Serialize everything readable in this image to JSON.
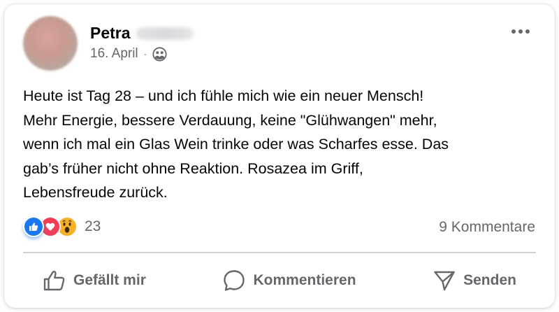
{
  "post": {
    "author_name": "Petra",
    "date": "16. April",
    "separator": "·",
    "audience_icon": "friends-icon",
    "text": "Heute ist Tag 28 – und ich fühle mich wie ein neuer Mensch!\nMehr Energie, bessere Verdauung, keine \"Glühwangen\" mehr,\nwenn ich mal ein Glas Wein trinke oder was Scharfes esse. Das\ngab’s früher nicht ohne Reaktion. Rosazea im Griff,\nLebensfreude zurück."
  },
  "reactions": {
    "icons": [
      "like-icon",
      "love-icon",
      "wow-icon"
    ],
    "count": "23"
  },
  "comments": {
    "label": "9 Kommentare"
  },
  "actions": {
    "like_label": "Gefällt mir",
    "comment_label": "Kommentieren",
    "send_label": "Senden"
  },
  "colors": {
    "text": "#050505",
    "secondary_text": "#65676b",
    "like_blue": "#1877f2",
    "love_red": "#f33e58",
    "wow_yellow": "#f7b125",
    "divider": "#ced0d4"
  }
}
